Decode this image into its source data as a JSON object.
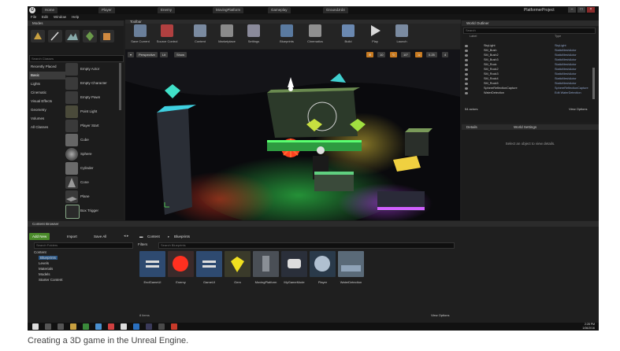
{
  "window": {
    "tabs": [
      "Home",
      "Player",
      "Enemy",
      "MovingPlatform",
      "Gameplay",
      "GroundJrd4"
    ],
    "project": "PlatformerProject",
    "menu": [
      "File",
      "Edit",
      "Window",
      "Help"
    ]
  },
  "modes": {
    "header": "Modes",
    "search_placeholder": "Search Classes",
    "categories": [
      "Recently Placed",
      "Basic",
      "Lights",
      "Cinematic",
      "Visual Effects",
      "Geometry",
      "Volumes",
      "All Classes"
    ],
    "selected_category": "Basic",
    "items": [
      "Empty Actor",
      "Empty Character",
      "Empty Pawn",
      "Point Light",
      "Player Start",
      "Cube",
      "Sphere",
      "Cylinder",
      "Cone",
      "Plane",
      "Box Trigger"
    ]
  },
  "toolbar": {
    "header": "Toolbar",
    "tools": [
      "Save Current",
      "Source Control",
      "Content",
      "Marketplace",
      "Settings",
      "Blueprints",
      "Cinematics",
      "Build",
      "Play",
      "Launch"
    ]
  },
  "viewport": {
    "perspective": "Perspective",
    "lit": "Lit",
    "show": "Show",
    "snap_value": "10",
    "angle_value": "10°",
    "scale_value": "0.25",
    "cam_value": "4"
  },
  "outliner": {
    "header": "World Outliner",
    "search_placeholder": "Search",
    "columns": {
      "label": "Label",
      "type": "Type"
    },
    "rows": [
      {
        "name": "SkyLight",
        "type": "SkyLight"
      },
      {
        "name": "SM_Bush",
        "type": "StaticMeshActor"
      },
      {
        "name": "SM_Bush2",
        "type": "StaticMeshActor"
      },
      {
        "name": "SM_Bush3",
        "type": "StaticMeshActor"
      },
      {
        "name": "SM_Rock",
        "type": "StaticMeshActor"
      },
      {
        "name": "SM_Rock2",
        "type": "StaticMeshActor"
      },
      {
        "name": "SM_Rock3",
        "type": "StaticMeshActor"
      },
      {
        "name": "SM_Rock4",
        "type": "StaticMeshActor"
      },
      {
        "name": "SM_Rock5",
        "type": "StaticMeshActor"
      },
      {
        "name": "SphereReflectionCapture",
        "type": "SphereReflectionCapture"
      },
      {
        "name": "WaterDetection",
        "type": "Edit WaterDetection"
      }
    ],
    "count": "54 actors",
    "view_options": "View Options"
  },
  "details": {
    "tabs": [
      "Details",
      "World Settings"
    ],
    "empty_text": "Select an object to view details."
  },
  "content_browser": {
    "header": "Content Browser",
    "add_new": "Add New",
    "import": "Import",
    "save_all": "Save All",
    "path": [
      "Content",
      "Blueprints"
    ],
    "filters": "Filters",
    "search_folders": "Search Folders",
    "search_assets": "Search Blueprints",
    "tree": [
      "Content",
      "Blueprints",
      "Levels",
      "Materials",
      "Models",
      "Starter Content"
    ],
    "assets": [
      "EndGameUI",
      "Enemy",
      "GameUI",
      "Gem",
      "MovingPlatform",
      "MyGameMode",
      "Player",
      "WaterDetection"
    ],
    "items_count": "8 items",
    "view_options": "View Options"
  },
  "taskbar": {
    "time": "2:28 PM",
    "date": "1/06/2016"
  },
  "caption": "Creating a 3D game in the Unreal Engine.",
  "colors": {
    "accent_green": "#4a8a2a",
    "selection_blue": "#2d5a8a",
    "panel": "#1c1c1c"
  }
}
